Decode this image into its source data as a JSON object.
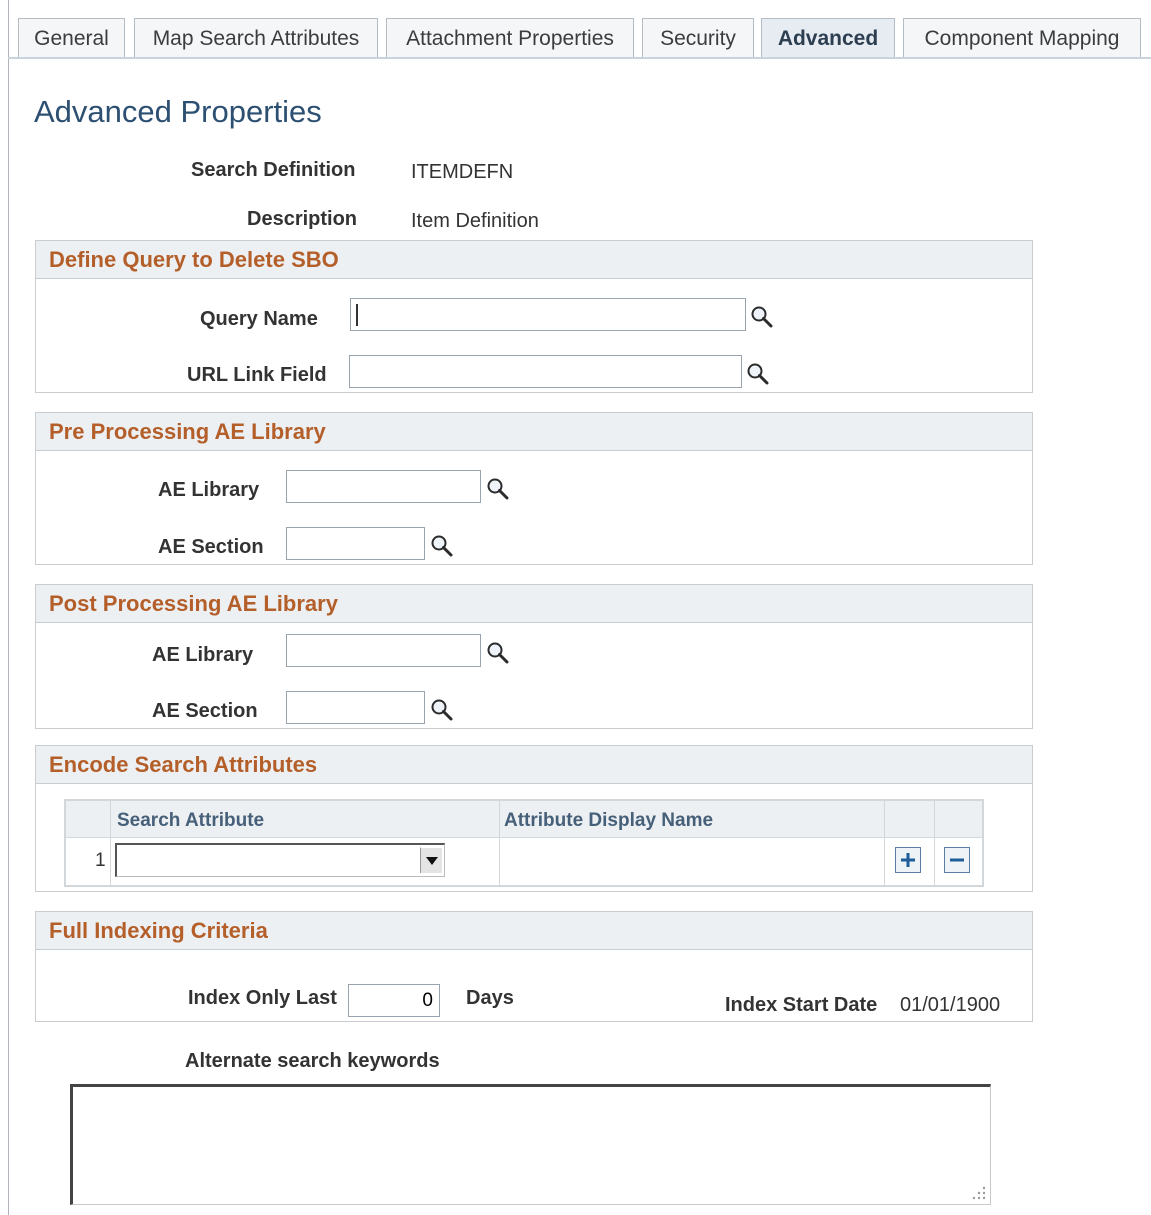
{
  "tabs": [
    {
      "label": "General"
    },
    {
      "label": "Map Search Attributes"
    },
    {
      "label": "Attachment Properties"
    },
    {
      "label": "Security"
    },
    {
      "label": "Advanced"
    },
    {
      "label": "Component Mapping"
    }
  ],
  "active_tab": "Advanced",
  "page_title": "Advanced Properties",
  "search_definition": {
    "label": "Search Definition",
    "value": "ITEMDEFN"
  },
  "description": {
    "label": "Description",
    "value": "Item Definition"
  },
  "delete_query": {
    "title": "Define Query to Delete SBO",
    "query_name_label": "Query Name",
    "query_name_value": "",
    "url_link_label": "URL Link Field",
    "url_link_value": ""
  },
  "pre_processing": {
    "title": "Pre Processing AE Library",
    "ae_library_label": "AE Library",
    "ae_library_value": "",
    "ae_section_label": "AE Section",
    "ae_section_value": ""
  },
  "post_processing": {
    "title": "Post Processing AE Library",
    "ae_library_label": "AE Library",
    "ae_library_value": "",
    "ae_section_label": "AE Section",
    "ae_section_value": ""
  },
  "encode": {
    "title": "Encode Search Attributes",
    "columns": [
      "Search Attribute",
      "Attribute Display Name"
    ],
    "rows": [
      {
        "num": "1",
        "search_attribute": "",
        "display_name": ""
      }
    ]
  },
  "full_indexing": {
    "title": "Full Indexing Criteria",
    "index_only_last_label": "Index Only Last",
    "index_only_last_value": "0",
    "days_label": "Days",
    "index_start_date_label": "Index Start Date",
    "index_start_date_value": "01/01/1900"
  },
  "alternate_keywords": {
    "label": "Alternate search keywords",
    "value": ""
  },
  "icons": {
    "lookup": "magnifier-icon",
    "add": "plus-icon",
    "remove": "minus-icon",
    "dropdown": "triangle-down-icon"
  },
  "colors": {
    "title": "#2d5072",
    "group_title": "#b45f2a",
    "group_header_bg": "#edf0f3",
    "column_header": "#47607a"
  }
}
